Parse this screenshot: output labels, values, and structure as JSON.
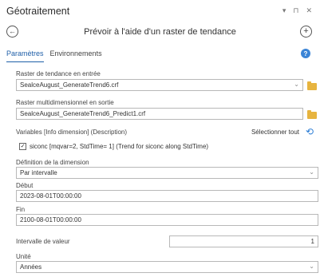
{
  "titlebar": {
    "title": "Géotraitement",
    "ctrl_pin": "▾",
    "ctrl_autohide": "⊓",
    "ctrl_close": "✕"
  },
  "tool": {
    "back_icon": "back-arrow-icon",
    "title": "Prévoir à l'aide d'un raster de tendance",
    "add_icon": "plus-icon"
  },
  "tabs": {
    "params": "Paramètres",
    "env": "Environnements"
  },
  "form": {
    "input_raster_label": "Raster de tendance en entrée",
    "input_raster_value": "SealceAugust_GenerateTrend6.crf",
    "output_raster_label": "Raster multidimensionnel en sortie",
    "output_raster_value": "SealceAugust_GenerateTrend6_Predict1.crf",
    "variables_label": "Variables [Info dimension] (Description)",
    "select_all": "Sélectionner tout",
    "variable_item": "siconc [mqvar=2, StdTime= 1] (Trend for siconc along StdTime)",
    "variable_checked": true,
    "dim_def_label": "Définition de la dimension",
    "dim_def_value": "Par intervalle",
    "start_label": "Début",
    "start_value": "2023-08-01T00:00:00",
    "end_label": "Fin",
    "end_value": "2100-08-01T00:00:00",
    "interval_label": "Intervalle de valeur",
    "interval_value": "1",
    "unit_label": "Unité",
    "unit_value": "Années"
  },
  "colors": {
    "accent": "#1f5fa8",
    "folder": "#e7b43f",
    "help": "#3b84d6"
  }
}
